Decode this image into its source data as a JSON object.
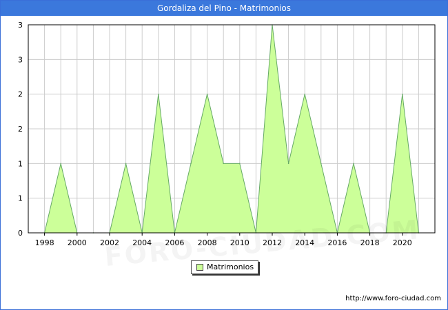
{
  "window": {
    "title": "Gordaliza del Pino - Matrimonios"
  },
  "footer": {
    "url": "http://www.foro-ciudad.com"
  },
  "watermark": {
    "text": "FORO-CIUDAD.COM"
  },
  "colors": {
    "title_bar": "#3b78dc",
    "area_fill": "#ccff99",
    "area_line": "#66aa66",
    "grid": "#cccccc"
  },
  "chart_data": {
    "type": "area",
    "title": "Gordaliza del Pino - Matrimonios",
    "xlabel": "",
    "ylabel": "",
    "x_ticks": [
      "1998",
      "2000",
      "2002",
      "2004",
      "2006",
      "2008",
      "2010",
      "2012",
      "2014",
      "2016",
      "2018",
      "2020"
    ],
    "y_tick_labels": [
      "0",
      "1",
      "1",
      "2",
      "2",
      "3",
      "3"
    ],
    "xlim": [
      1997,
      2022
    ],
    "ylim": [
      0,
      3
    ],
    "grid": true,
    "legend_position": "bottom-center",
    "series": [
      {
        "name": "Matrimonios",
        "x": [
          1998,
          1999,
          2000,
          2001,
          2002,
          2003,
          2004,
          2005,
          2006,
          2007,
          2008,
          2009,
          2010,
          2011,
          2012,
          2013,
          2014,
          2015,
          2016,
          2017,
          2018,
          2019,
          2020,
          2021
        ],
        "values": [
          0,
          1,
          0,
          0,
          0,
          1,
          0,
          2,
          0,
          1,
          2,
          1,
          1,
          0,
          3,
          1,
          2,
          1,
          0,
          1,
          0,
          0,
          2,
          0
        ]
      }
    ]
  }
}
